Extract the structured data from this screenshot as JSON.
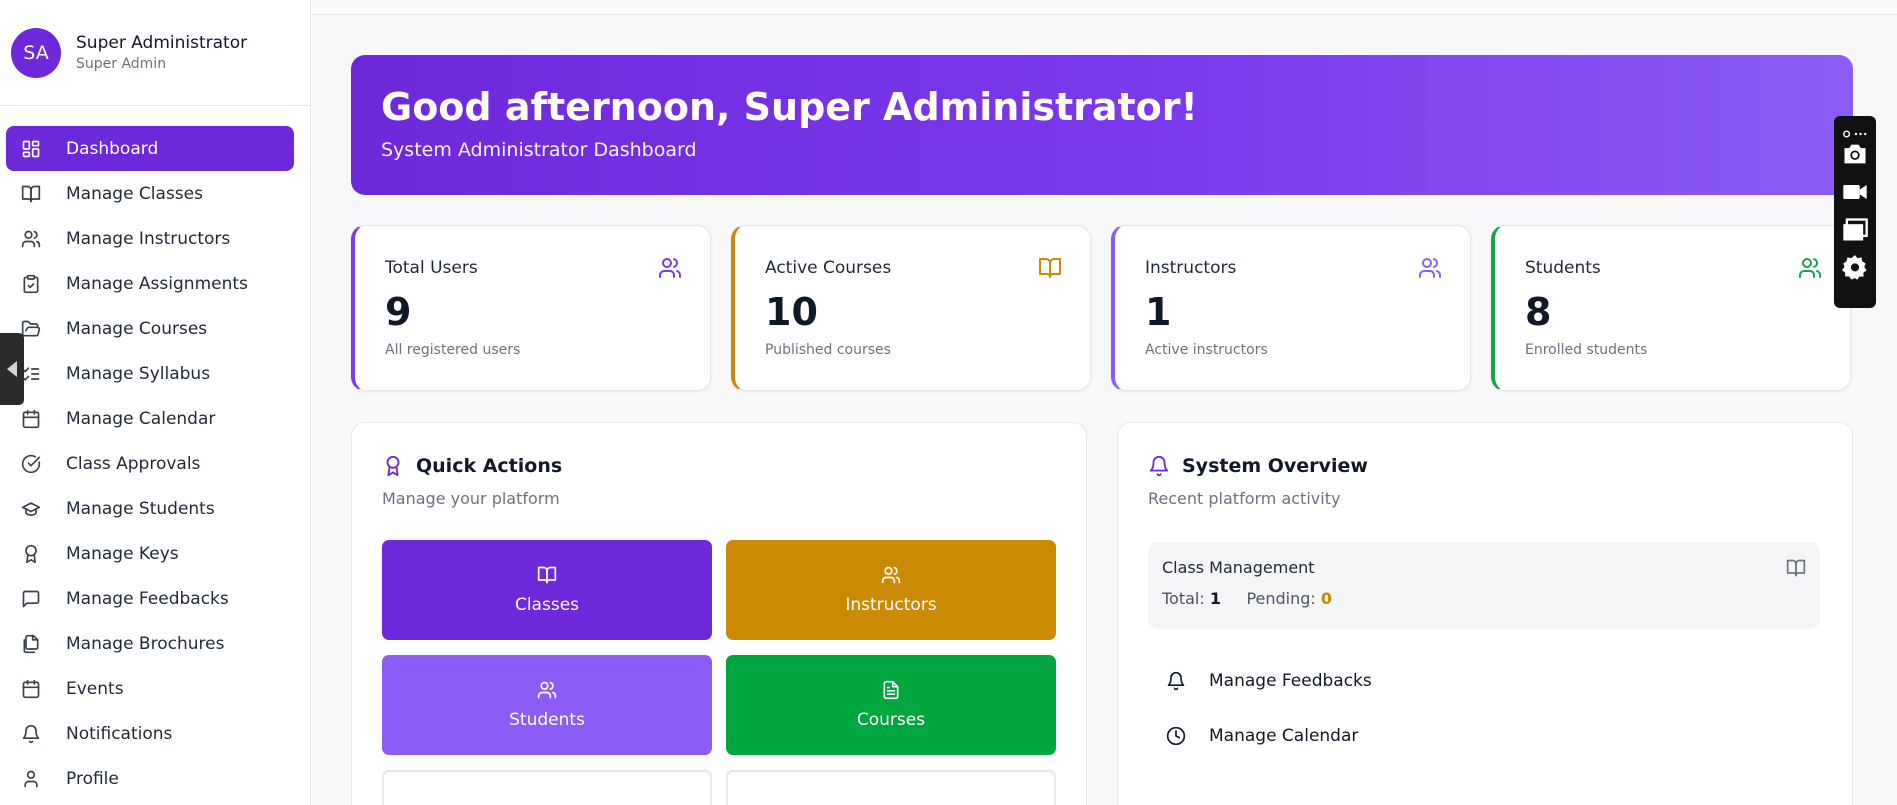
{
  "user": {
    "initials": "SA",
    "name": "Super Administrator",
    "role": "Super Admin"
  },
  "nav": [
    {
      "label": "Dashboard",
      "icon": "dashboard-icon",
      "active": true
    },
    {
      "label": "Manage Classes",
      "icon": "book-open-icon"
    },
    {
      "label": "Manage Instructors",
      "icon": "users-icon"
    },
    {
      "label": "Manage Assignments",
      "icon": "clipboard-check-icon"
    },
    {
      "label": "Manage Courses",
      "icon": "folder-open-icon"
    },
    {
      "label": "Manage Syllabus",
      "icon": "list-checks-icon"
    },
    {
      "label": "Manage Calendar",
      "icon": "calendar-icon"
    },
    {
      "label": "Class Approvals",
      "icon": "check-circle-icon"
    },
    {
      "label": "Manage Students",
      "icon": "graduation-cap-icon"
    },
    {
      "label": "Manage Keys",
      "icon": "award-icon"
    },
    {
      "label": "Manage Feedbacks",
      "icon": "message-square-icon"
    },
    {
      "label": "Manage Brochures",
      "icon": "files-icon"
    },
    {
      "label": "Events",
      "icon": "calendar-icon"
    },
    {
      "label": "Notifications",
      "icon": "bell-icon"
    },
    {
      "label": "Profile",
      "icon": "user-icon"
    }
  ],
  "hero": {
    "title": "Good afternoon, Super Administrator!",
    "subtitle": "System Administrator Dashboard"
  },
  "stats": [
    {
      "label": "Total Users",
      "value": "9",
      "desc": "All registered users",
      "color": "#7c3aed",
      "icon": "users-icon"
    },
    {
      "label": "Active Courses",
      "value": "10",
      "desc": "Published courses",
      "color": "#ca8a04",
      "icon": "book-open-icon"
    },
    {
      "label": "Instructors",
      "value": "1",
      "desc": "Active instructors",
      "color": "#8b5cf6",
      "icon": "users-icon"
    },
    {
      "label": "Students",
      "value": "8",
      "desc": "Enrolled students",
      "color": "#16a34a",
      "icon": "users-icon"
    }
  ],
  "quick_actions": {
    "title": "Quick Actions",
    "subtitle": "Manage your platform",
    "buttons": [
      {
        "label": "Classes",
        "color": "#6d28d9",
        "icon": "book-open-icon"
      },
      {
        "label": "Instructors",
        "color": "#ca8a04",
        "icon": "users-icon"
      },
      {
        "label": "Students",
        "color": "#8b5cf6",
        "icon": "users-icon"
      },
      {
        "label": "Courses",
        "color": "#00a63e",
        "icon": "file-text-icon"
      }
    ]
  },
  "overview": {
    "title": "System Overview",
    "subtitle": "Recent platform activity",
    "class_mgmt": {
      "title": "Class Management",
      "total_label": "Total:",
      "total": "1",
      "pending_label": "Pending:",
      "pending": "0"
    },
    "items": [
      {
        "label": "Manage Feedbacks",
        "icon": "bell-icon"
      },
      {
        "label": "Manage Calendar",
        "icon": "clock-icon"
      }
    ]
  }
}
